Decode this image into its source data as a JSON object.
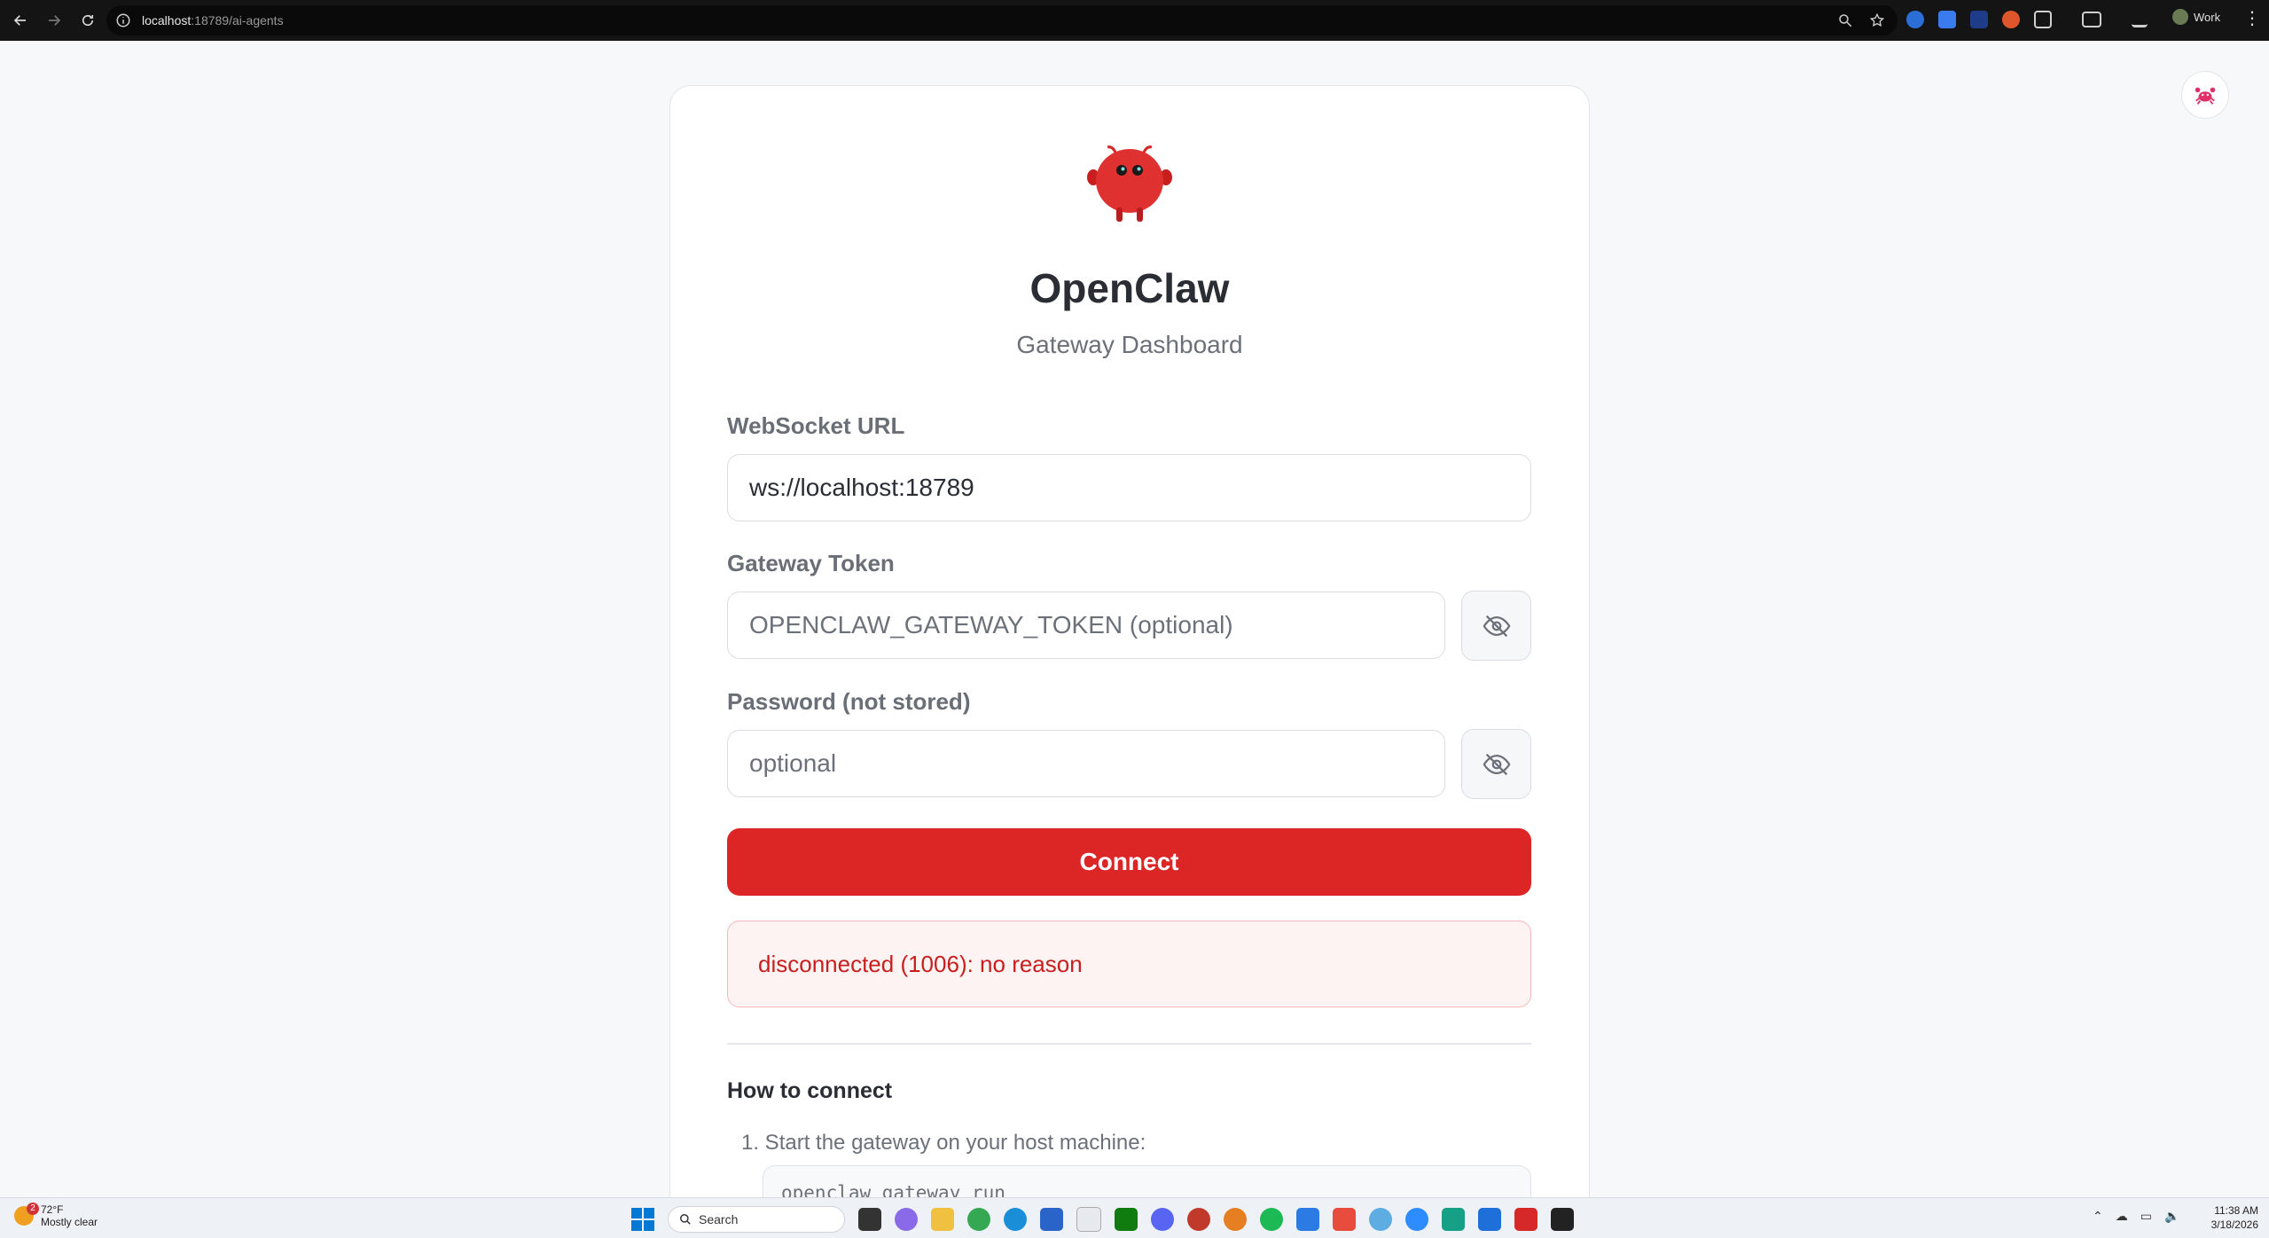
{
  "browser": {
    "url_host": "localhost",
    "url_path": ":18789/ai-agents",
    "profile_name": "Work"
  },
  "app": {
    "title": "OpenClaw",
    "subtitle": "Gateway Dashboard"
  },
  "form": {
    "websocket_label": "WebSocket URL",
    "websocket_value": "ws://localhost:18789",
    "token_label": "Gateway Token",
    "token_placeholder": "OPENCLAW_GATEWAY_TOKEN (optional)",
    "password_label": "Password (not stored)",
    "password_placeholder": "optional",
    "connect_label": "Connect"
  },
  "status": {
    "error_text": "disconnected (1006): no reason"
  },
  "help": {
    "title": "How to connect",
    "step1": "1. Start the gateway on your host machine:",
    "code": "openclaw gateway run"
  },
  "taskbar": {
    "weather_temp": "72°F",
    "weather_desc": "Mostly clear",
    "weather_badge": "2",
    "search_label": "Search",
    "time": "11:38 AM",
    "date": "3/18/2026"
  },
  "colors": {
    "accent": "#dc2626",
    "error_bg": "#fef3f3",
    "error_text": "#c81e1e"
  }
}
